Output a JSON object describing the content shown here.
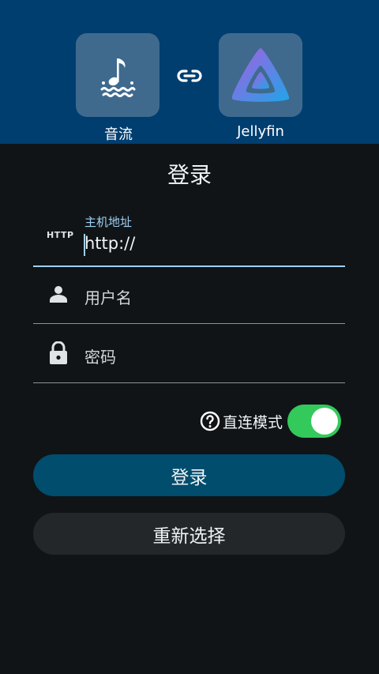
{
  "header": {
    "source_app_label": "音流",
    "target_app_label": "Jellyfin",
    "source_icon": "music-note-waves-icon",
    "target_icon": "jellyfin-logo",
    "link_icon": "link-icon"
  },
  "page_title": "登录",
  "form": {
    "host": {
      "badge": "HTTP",
      "label": "主机地址",
      "value": "http://"
    },
    "username": {
      "placeholder": "用户名",
      "icon": "person-icon"
    },
    "password": {
      "placeholder": "密码",
      "icon": "lock-icon"
    },
    "direct_mode": {
      "label": "直连模式",
      "icon": "help-circle-icon",
      "enabled": true
    }
  },
  "buttons": {
    "login_label": "登录",
    "reselect_label": "重新选择"
  },
  "colors": {
    "header_bg": "#003e70",
    "tile_bg": "#3f6a8e",
    "page_bg": "#101417",
    "accent": "#9fd0f2",
    "login_button": "#004d6e",
    "reselect_button": "#23272a",
    "toggle_on": "#34c95b"
  }
}
